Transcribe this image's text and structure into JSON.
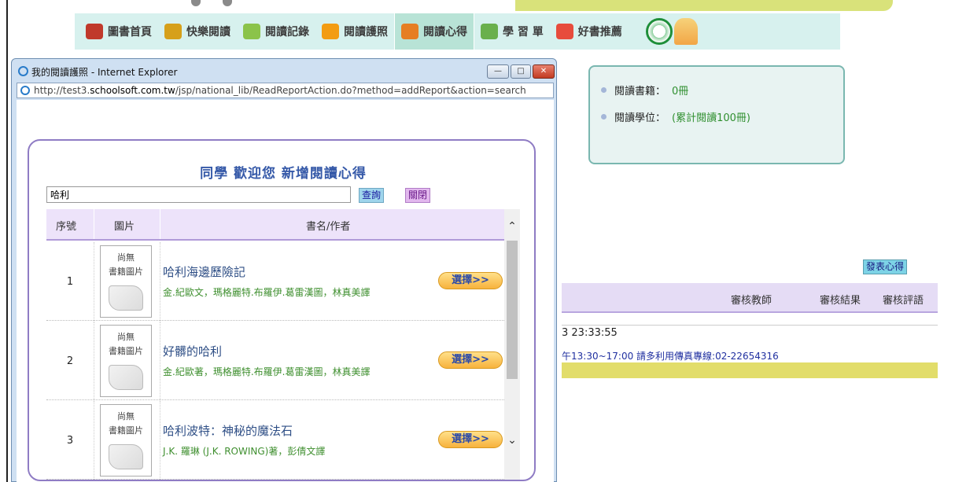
{
  "nav": {
    "items": [
      {
        "label": "圖書首頁",
        "icon": "books-icon",
        "color": "#c0392b"
      },
      {
        "label": "快樂閱讀",
        "icon": "reader-icon",
        "color": "#d6a01a"
      },
      {
        "label": "閱讀記錄",
        "icon": "pencil-icon",
        "color": "#8bc34a"
      },
      {
        "label": "閱讀護照",
        "icon": "passport-icon",
        "color": "#f39c12"
      },
      {
        "label": "閱讀心得",
        "icon": "notebook-icon",
        "color": "#e67e22"
      },
      {
        "label": "學 習 單",
        "icon": "worksheet-icon",
        "color": "#6ab04c"
      },
      {
        "label": "好書推薦",
        "icon": "recommend-icon",
        "color": "#e74c3c"
      }
    ]
  },
  "info": {
    "books_label": "閱讀書籍：",
    "books_value": "0冊",
    "degree_label": "閱讀學位：",
    "degree_value": "(累計閱讀100冊)"
  },
  "right_panel": {
    "publish_label": "發表心得",
    "col_teacher": "審核教師",
    "col_result": "審核結果",
    "col_comment": "審核評語",
    "time_text": "3 23:33:55",
    "notice_text": "午13:30~17:00 請多利用傳真專線:02-22654316"
  },
  "ie": {
    "window_title": "我的閱讀護照 - Internet Explorer",
    "url_prefix": "http://test3.",
    "url_domain": "schoolsoft.com.tw",
    "url_path": "/jsp/national_lib/ReadReportAction.do?method=addReport&action=search",
    "minimize_label": "—",
    "maximize_label": "□",
    "close_label": "✕"
  },
  "dialog": {
    "title": "同學 歡迎您 新增閱讀心得",
    "search_value": "哈利",
    "query_label": "查詢",
    "close_label": "關閉",
    "columns": {
      "seq": "序號",
      "image": "圖片",
      "book": "書名/作者"
    },
    "no_image_line1": "尚無",
    "no_image_line2": "書籍圖片",
    "select_label": "選擇>>",
    "rows": [
      {
        "seq": "1",
        "title": "哈利海邊歷險記",
        "author": "金.紀歐文，瑪格麗特.布羅伊.葛雷漢圖，林真美譯"
      },
      {
        "seq": "2",
        "title": "好髒的哈利",
        "author": "金.紀歐著，瑪格麗特.布羅伊.葛雷漢圖，林真美譯"
      },
      {
        "seq": "3",
        "title": "哈利波特：神秘的魔法石",
        "author": "J.K. 羅琳 (J.K. ROWING)著，彭倩文譯"
      }
    ]
  }
}
